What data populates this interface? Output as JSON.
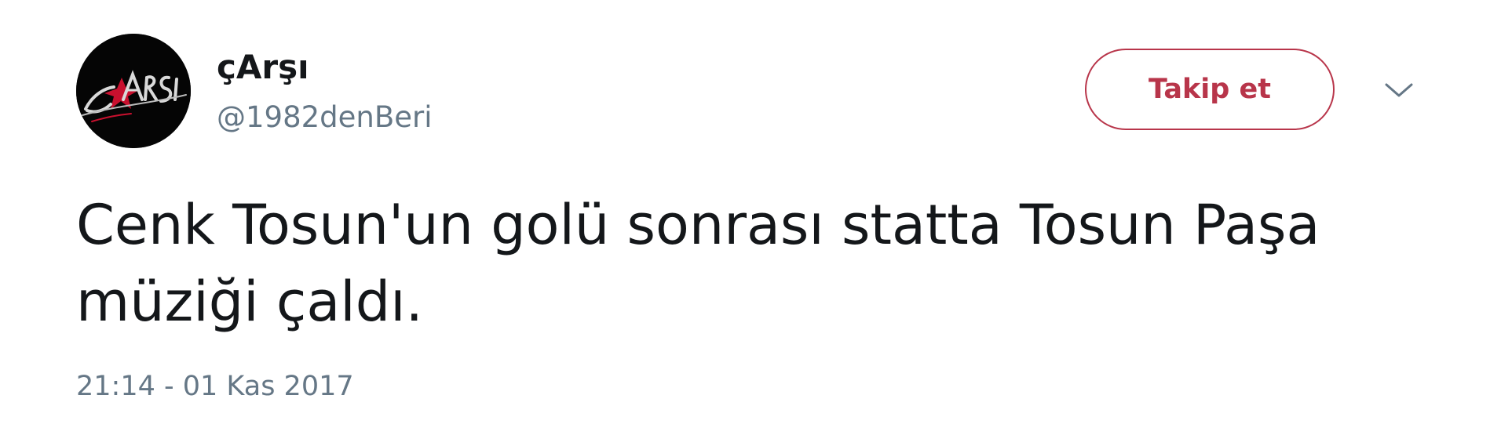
{
  "user": {
    "display_name": "çArşı",
    "handle": "@1982denBeri",
    "avatar": "carsi-logo-icon",
    "avatar_logo_text": "çArşı"
  },
  "actions": {
    "follow_label": "Takip et",
    "more_icon": "chevron-down-icon"
  },
  "tweet": {
    "text": "Cenk Tosun'un golü sonrası statta Tosun Paşa müziği çaldı.",
    "timestamp": "21:14 - 01 Kas 2017"
  },
  "colors": {
    "accent": "#b8354a",
    "text": "#14171a",
    "muted": "#657786",
    "avatar_bg": "#050505",
    "logo_red": "#c8102e"
  }
}
